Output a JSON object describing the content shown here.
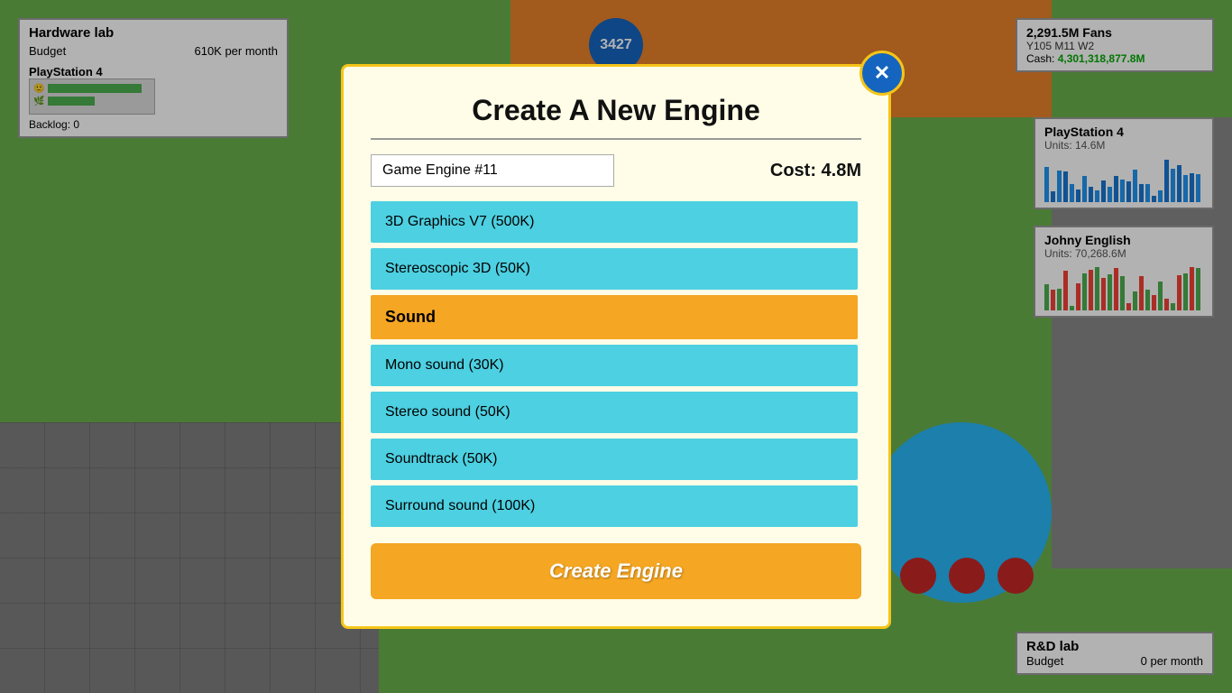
{
  "hardware_lab": {
    "title": "Hardware lab",
    "budget_label": "Budget",
    "budget_value": "610K per month",
    "platform": "PlayStation 4",
    "backlog": "Backlog: 0"
  },
  "stats": {
    "fans": "2,291.5M Fans",
    "date": "Y105 M11 W2",
    "cash_label": "Cash:",
    "cash_value": "4,301,318,877.8M"
  },
  "ps4_panel": {
    "title": "PlayStation 4",
    "units": "Units: 14.6M"
  },
  "johny_panel": {
    "title": "Johny English",
    "units": "Units: 70,268.6M"
  },
  "rd_lab": {
    "title": "R&D lab",
    "budget_label": "Budget",
    "budget_value": "0 per month"
  },
  "badge": {
    "value": "3427"
  },
  "modal": {
    "title": "Create A New Engine",
    "close_icon": "✕",
    "engine_name": "Game Engine #11",
    "cost_label": "Cost: 4.8M",
    "features": [
      {
        "type": "item",
        "label": "3D Graphics V7 (500K)"
      },
      {
        "type": "item",
        "label": "Stereoscopic 3D (50K)"
      },
      {
        "type": "category",
        "label": "Sound"
      },
      {
        "type": "item",
        "label": "Mono sound (30K)"
      },
      {
        "type": "item",
        "label": "Stereo sound (50K)"
      },
      {
        "type": "item",
        "label": "Soundtrack (50K)"
      },
      {
        "type": "item",
        "label": "Surround sound (100K)"
      }
    ],
    "create_button_label": "Create Engine"
  }
}
